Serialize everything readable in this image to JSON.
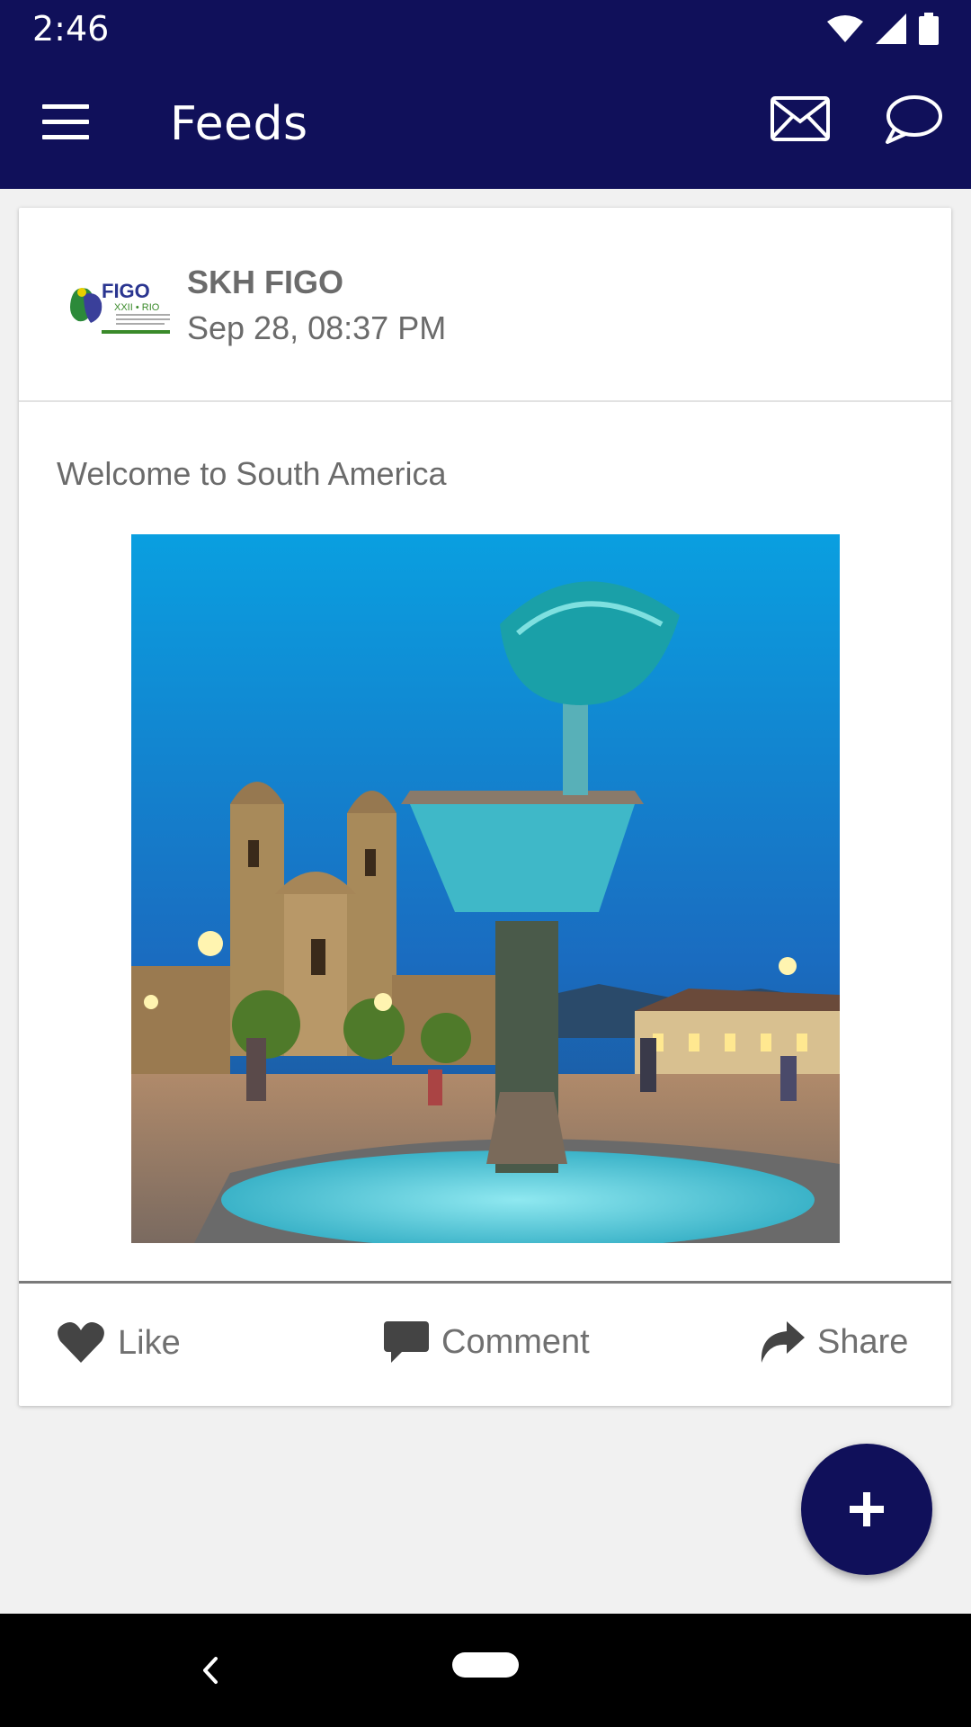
{
  "status_bar": {
    "time": "2:46",
    "icons": [
      "wifi-icon",
      "cell-signal-icon",
      "battery-icon"
    ]
  },
  "app_bar": {
    "title": "Feeds",
    "icons": [
      "menu-icon",
      "mail-icon",
      "chat-icon"
    ],
    "background_color": "#10105a"
  },
  "post": {
    "author": {
      "name": "SKH FIGO",
      "logo": {
        "main_text": "FIGO",
        "sub_text": "XXII • RIO",
        "fine_print": "WORLD CONGRESS OF GYNECOLOGY AND OBSTETRICS"
      }
    },
    "timestamp": "Sep 28, 08:37 PM",
    "text": "Welcome to South America",
    "image_description_icon": "photo-fountain-plaza"
  },
  "actions": {
    "like": "Like",
    "comment": "Comment",
    "share": "Share"
  },
  "fab": {
    "icon": "plus-icon"
  },
  "nav_bar": {
    "icons": [
      "back-icon",
      "home-pill-icon"
    ]
  }
}
